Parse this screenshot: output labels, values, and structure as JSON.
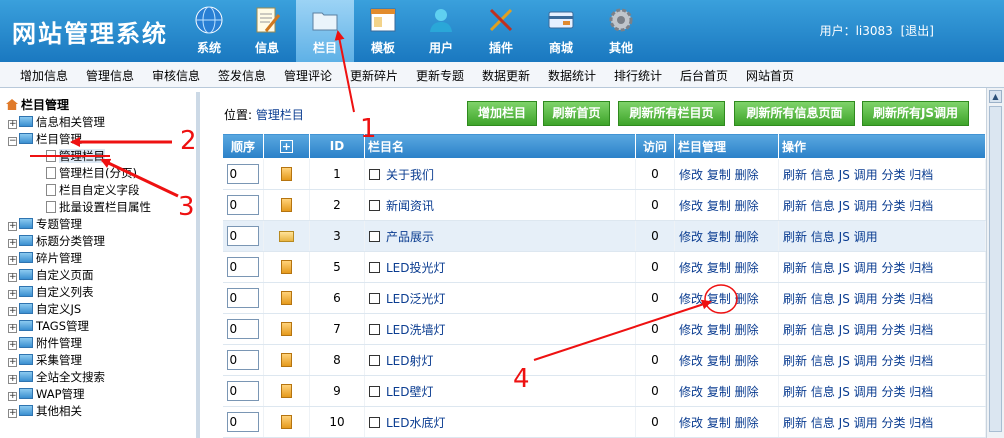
{
  "app": {
    "title": "网站管理系统"
  },
  "topnav": [
    {
      "label": "系统",
      "icon": "globe-icon"
    },
    {
      "label": "信息",
      "icon": "document-edit-icon"
    },
    {
      "label": "栏目",
      "icon": "folder-icon",
      "active": true
    },
    {
      "label": "模板",
      "icon": "window-icon"
    },
    {
      "label": "用户",
      "icon": "user-icon"
    },
    {
      "label": "插件",
      "icon": "tools-icon"
    },
    {
      "label": "商城",
      "icon": "card-icon"
    },
    {
      "label": "其他",
      "icon": "gear-icon"
    }
  ],
  "user": {
    "label": "用户：li3083",
    "logout": "[退出]"
  },
  "subnav": [
    "增加信息",
    "管理信息",
    "审核信息",
    "签发信息",
    "管理评论",
    "更新碎片",
    "更新专题",
    "数据更新",
    "数据统计",
    "排行统计",
    "后台首页",
    "网站首页"
  ],
  "tree": {
    "title": "栏目管理",
    "nodes": [
      {
        "label": "信息相关管理",
        "expanded": false
      },
      {
        "label": "栏目管理",
        "expanded": true
      },
      {
        "label": "专题管理"
      },
      {
        "label": "标题分类管理"
      },
      {
        "label": "碎片管理"
      },
      {
        "label": "自定义页面"
      },
      {
        "label": "自定义列表"
      },
      {
        "label": "自定义JS"
      },
      {
        "label": "TAGS管理"
      },
      {
        "label": "附件管理"
      },
      {
        "label": "采集管理"
      },
      {
        "label": "全站全文搜索"
      },
      {
        "label": "WAP管理"
      },
      {
        "label": "其他相关"
      }
    ],
    "children": [
      "管理栏目",
      "管理栏目(分页)",
      "栏目自定义字段",
      "批量设置栏目属性"
    ]
  },
  "location": {
    "prefix": "位置:",
    "link": "管理栏目"
  },
  "buttons": [
    "增加栏目",
    "刷新首页",
    "刷新所有栏目页",
    "刷新所有信息页面",
    "刷新所有JS调用"
  ],
  "table": {
    "headers": {
      "order": "顺序",
      "id": "ID",
      "name": "栏目名",
      "visits": "访问",
      "manage": "栏目管理",
      "ops": "操作"
    },
    "rows": [
      {
        "order": "0",
        "id": "1",
        "name": "关于我们",
        "visits": "0",
        "folder": false
      },
      {
        "order": "0",
        "id": "2",
        "name": "新闻资讯",
        "visits": "0",
        "folder": false
      },
      {
        "order": "0",
        "id": "3",
        "name": "产品展示",
        "visits": "0",
        "folder": true
      },
      {
        "order": "0",
        "id": "5",
        "name": "LED投光灯",
        "visits": "0",
        "folder": false
      },
      {
        "order": "0",
        "id": "6",
        "name": "LED泛光灯",
        "visits": "0",
        "folder": false
      },
      {
        "order": "0",
        "id": "7",
        "name": "LED洗墙灯",
        "visits": "0",
        "folder": false
      },
      {
        "order": "0",
        "id": "8",
        "name": "LED射灯",
        "visits": "0",
        "folder": false
      },
      {
        "order": "0",
        "id": "9",
        "name": "LED壁灯",
        "visits": "0",
        "folder": false
      },
      {
        "order": "0",
        "id": "10",
        "name": "LED水底灯",
        "visits": "0",
        "folder": false
      }
    ],
    "manage_links": [
      "修改",
      "复制",
      "删除"
    ],
    "op_links": [
      "刷新",
      "信息",
      "JS 调用",
      "分类",
      "归档"
    ],
    "op_links_folder": [
      "刷新",
      "信息",
      "JS 调用"
    ]
  },
  "annotations": [
    "1",
    "2",
    "3",
    "4"
  ]
}
